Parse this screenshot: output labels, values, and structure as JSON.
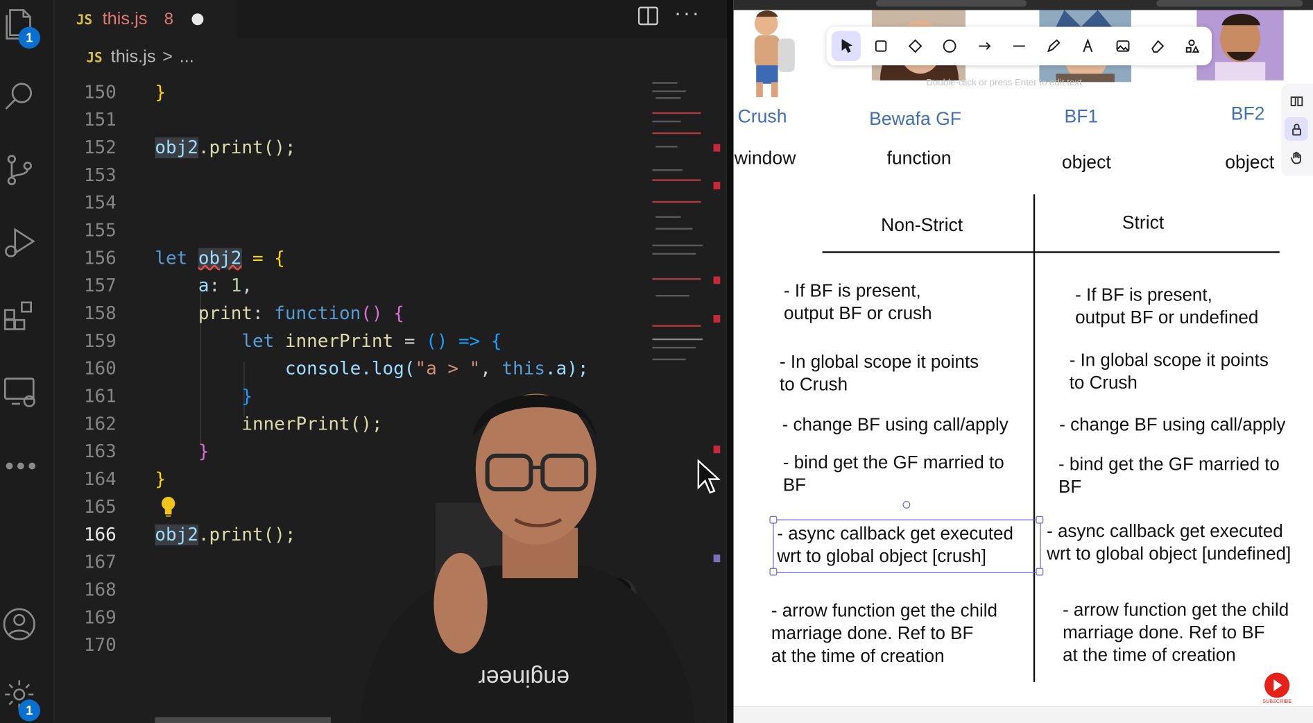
{
  "editor": {
    "tab": {
      "lang_badge": "JS",
      "filename": "this.js",
      "problem_count": "8"
    },
    "breadcrumb": {
      "lang_badge": "JS",
      "file": "this.js",
      "separator": ">",
      "more": "..."
    },
    "activity_badges": {
      "explorer": "1",
      "settings": "1"
    },
    "lines": [
      {
        "num": "150"
      },
      {
        "num": "151"
      },
      {
        "num": "152"
      },
      {
        "num": "153"
      },
      {
        "num": "154"
      },
      {
        "num": "155"
      },
      {
        "num": "156"
      },
      {
        "num": "157"
      },
      {
        "num": "158"
      },
      {
        "num": "159"
      },
      {
        "num": "160"
      },
      {
        "num": "161"
      },
      {
        "num": "162"
      },
      {
        "num": "163"
      },
      {
        "num": "164"
      },
      {
        "num": "165"
      },
      {
        "num": "166"
      },
      {
        "num": "167"
      },
      {
        "num": "168"
      },
      {
        "num": "169"
      },
      {
        "num": "170"
      }
    ],
    "tokens": {
      "obj2": "obj2",
      "print_call": ".print();",
      "let": "let",
      "eq_open": " = {",
      "a_key": "a",
      "a_val": "1",
      "print_key": "print",
      "function_kw": "function",
      "inner_decl": "innerPrint",
      "arrow": "() => {",
      "console": "console.log(",
      "str_literal": "\"a > \"",
      "this_kw": "this",
      "this_prop": ".a);",
      "inner_call": "innerPrint();",
      "close_brace": "}",
      "close_paren_brace": "() {"
    }
  },
  "whiteboard": {
    "toolbar_hint": "Double-click or press Enter to edit text",
    "characters": [
      {
        "name": "Crush",
        "type": "window"
      },
      {
        "name": "Bewafa GF",
        "type": "function"
      },
      {
        "name": "BF1",
        "type": "object"
      },
      {
        "name": "BF2",
        "type": "object"
      }
    ],
    "columns": {
      "left": "Non-Strict",
      "right": "Strict"
    },
    "non_strict": [
      "- If BF is present,\noutput BF or crush",
      "- In global scope it points\nto Crush",
      "- change BF using call/apply",
      "- bind get the GF married to\nBF",
      "- async callback get executed\nwrt to global object [crush]",
      "- arrow function get the child\nmarriage done. Ref to BF\nat the time of creation"
    ],
    "strict": [
      "- If BF is present,\noutput BF or undefined",
      "- In global scope it points\nto Crush",
      "- change BF using call/apply",
      "- bind get the GF married to\nBF",
      "- async callback get executed\nwrt to global object [undefined]",
      "- arrow function get the child\nmarriage done. Ref to BF\nat the time of creation"
    ],
    "subscribe_label": "SUBSCRIBE"
  },
  "presenter": {
    "shirt_text": "engineer"
  }
}
